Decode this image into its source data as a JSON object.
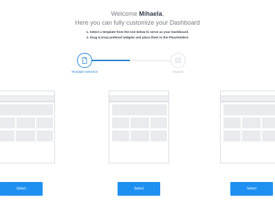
{
  "header": {
    "welcome_prefix": "Welcome ",
    "user_name": "Mihaela",
    "welcome_suffix": ",",
    "subtitle": "Here you can fully customize your Dashboard",
    "instruction_1": "1. Select a template from the one below to serve as your Dashboard.",
    "instruction_2": "2. Drag & Drop prefered widgets  and place them in the Placeholders"
  },
  "stepper": {
    "steps": [
      {
        "label": "Template Selection",
        "icon": "document-icon",
        "state": "active"
      },
      {
        "label": "Widgets",
        "icon": "grid-icon",
        "state": "inactive"
      }
    ]
  },
  "templates": [
    {
      "select_label": "Select"
    },
    {
      "select_label": "Select"
    },
    {
      "select_label": "Select"
    }
  ],
  "colors": {
    "accent": "#1e7fd6",
    "button": "#1e90f2",
    "placeholder": "#e9ebee"
  }
}
